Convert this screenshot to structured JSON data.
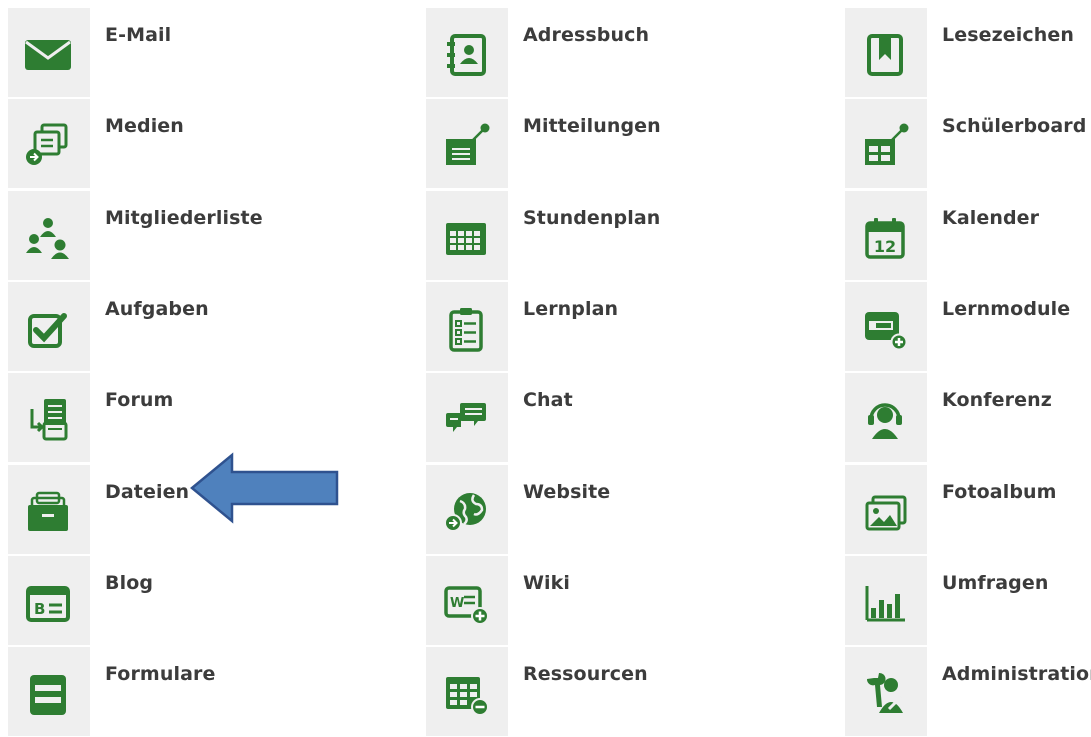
{
  "colors": {
    "icon": "#2e7d32",
    "tile": "#efefef",
    "label": "#3c3c3c",
    "arrow_fill": "#4f81bd",
    "arrow_stroke": "#2f528f"
  },
  "columns": [
    [
      {
        "id": "email",
        "label": "E-Mail",
        "icon": "envelope-icon"
      },
      {
        "id": "medien",
        "label": "Medien",
        "icon": "media-stack-icon"
      },
      {
        "id": "mitgliederliste",
        "label": "Mitgliederliste",
        "icon": "members-icon"
      },
      {
        "id": "aufgaben",
        "label": "Aufgaben",
        "icon": "checkbox-icon"
      },
      {
        "id": "forum",
        "label": "Forum",
        "icon": "forum-icon"
      },
      {
        "id": "dateien",
        "label": "Dateien",
        "icon": "briefcase-icon"
      },
      {
        "id": "blog",
        "label": "Blog",
        "icon": "blog-icon"
      },
      {
        "id": "formulare",
        "label": "Formulare",
        "icon": "form-icon"
      }
    ],
    [
      {
        "id": "adressbuch",
        "label": "Adressbuch",
        "icon": "address-book-icon"
      },
      {
        "id": "mitteilungen",
        "label": "Mitteilungen",
        "icon": "notice-board-icon"
      },
      {
        "id": "stundenplan",
        "label": "Stundenplan",
        "icon": "timetable-icon"
      },
      {
        "id": "lernplan",
        "label": "Lernplan",
        "icon": "clipboard-list-icon"
      },
      {
        "id": "chat",
        "label": "Chat",
        "icon": "chat-bubbles-icon"
      },
      {
        "id": "website",
        "label": "Website",
        "icon": "globe-icon"
      },
      {
        "id": "wiki",
        "label": "Wiki",
        "icon": "wiki-icon"
      },
      {
        "id": "ressourcen",
        "label": "Ressourcen",
        "icon": "resources-table-icon"
      }
    ],
    [
      {
        "id": "lesezeichen",
        "label": "Lesezeichen",
        "icon": "bookmark-icon"
      },
      {
        "id": "schuelerboard",
        "label": "Schülerboard",
        "icon": "student-board-icon"
      },
      {
        "id": "kalender",
        "label": "Kalender",
        "icon": "calendar-icon",
        "calendar_day": "12"
      },
      {
        "id": "lernmodule",
        "label": "Lernmodule",
        "icon": "learning-module-icon"
      },
      {
        "id": "konferenz",
        "label": "Konferenz",
        "icon": "headset-icon"
      },
      {
        "id": "fotoalbum",
        "label": "Fotoalbum",
        "icon": "photo-album-icon"
      },
      {
        "id": "umfragen",
        "label": "Umfragen",
        "icon": "bar-chart-icon"
      },
      {
        "id": "administration",
        "label": "Administration",
        "icon": "admin-tools-icon"
      }
    ]
  ],
  "annotation": {
    "type": "arrow",
    "points_to": "dateien",
    "direction": "left"
  }
}
